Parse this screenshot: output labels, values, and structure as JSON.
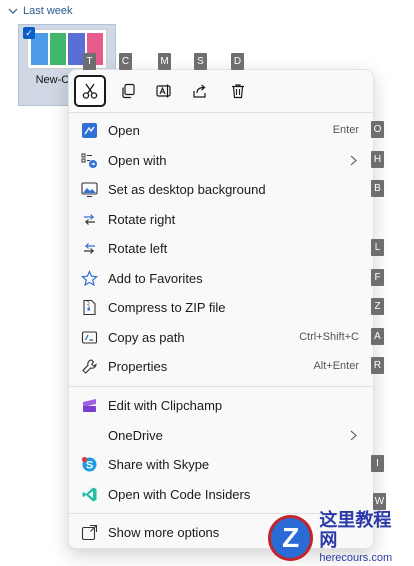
{
  "group": {
    "label": "Last week"
  },
  "file": {
    "name": "New-Cha...er",
    "checkmark": "✓"
  },
  "toolbar": {
    "buttons": [
      {
        "name": "cut",
        "icon": "scissors-icon",
        "key": "T"
      },
      {
        "name": "copy",
        "icon": "copy-icon",
        "key": "C"
      },
      {
        "name": "rename",
        "icon": "rename-icon",
        "key": "M"
      },
      {
        "name": "share",
        "icon": "share-icon",
        "key": "S"
      },
      {
        "name": "delete",
        "icon": "trash-icon",
        "key": "D"
      }
    ]
  },
  "menu": {
    "items": [
      {
        "label": "Open",
        "shortcut": "Enter",
        "key": "O",
        "icon": "open-app-icon"
      },
      {
        "label": "Open with",
        "shortcut": "",
        "key": "H",
        "icon": "open-with-icon"
      },
      {
        "label": "Set as desktop background",
        "shortcut": "",
        "key": "B",
        "icon": "desktop-background-icon"
      },
      {
        "label": "Rotate right",
        "shortcut": "",
        "key": "",
        "icon": "rotate-right-icon"
      },
      {
        "label": "Rotate left",
        "shortcut": "",
        "key": "L",
        "icon": "rotate-left-icon"
      },
      {
        "label": "Add to Favorites",
        "shortcut": "",
        "key": "F",
        "icon": "star-icon"
      },
      {
        "label": "Compress to ZIP file",
        "shortcut": "",
        "key": "Z",
        "icon": "zip-icon"
      },
      {
        "label": "Copy as path",
        "shortcut": "Ctrl+Shift+C",
        "key": "A",
        "icon": "copy-path-icon"
      },
      {
        "label": "Properties",
        "shortcut": "Alt+Enter",
        "key": "R",
        "icon": "wrench-icon"
      },
      {
        "label": "Edit with Clipchamp",
        "shortcut": "",
        "key": "",
        "icon": "clipchamp-icon"
      },
      {
        "label": "OneDrive",
        "shortcut": "",
        "key": "",
        "icon": ""
      },
      {
        "label": "Share with Skype",
        "shortcut": "",
        "key": "I",
        "icon": "skype-icon"
      },
      {
        "label": "Open with Code Insiders",
        "shortcut": "",
        "key": "W",
        "icon": "vscode-icon"
      },
      {
        "label": "Show more options",
        "shortcut": "",
        "key": "",
        "icon": "more-options-icon"
      }
    ]
  },
  "watermark": {
    "logo": "Z",
    "title": "这里教程网",
    "url": "herecours.com"
  },
  "colors": {
    "accent": "#0a5fc7",
    "key_bg": "#6e6e6e"
  }
}
